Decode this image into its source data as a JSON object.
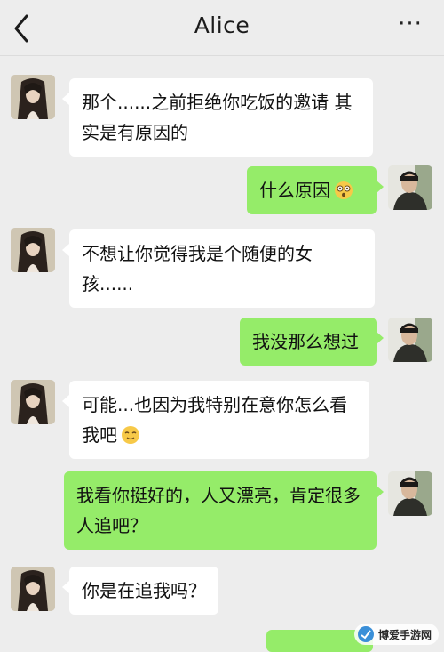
{
  "header": {
    "title": "Alice",
    "back_icon": "chevron-left-icon",
    "more_label": "···"
  },
  "messages": [
    {
      "side": "left",
      "text": "那个......之前拒绝你吃饭的邀请 其实是有原因的"
    },
    {
      "side": "right",
      "text": "什么原因",
      "emoji": "dizzy-face-emoji"
    },
    {
      "side": "left",
      "text": "不想让你觉得我是个随便的女孩......"
    },
    {
      "side": "right",
      "text": "我没那么想过"
    },
    {
      "side": "left",
      "text": "可能...也因为我特别在意你怎么看我吧",
      "emoji": "relieved-face-emoji"
    },
    {
      "side": "right",
      "text": "我看你挺好的，人又漂亮，肯定很多人追吧？"
    },
    {
      "side": "left",
      "text": "你是在追我吗？"
    }
  ],
  "watermark": {
    "text": "博爱手游网"
  },
  "colors": {
    "background": "#ededed",
    "sent_bubble": "#95ec69",
    "received_bubble": "#ffffff"
  }
}
